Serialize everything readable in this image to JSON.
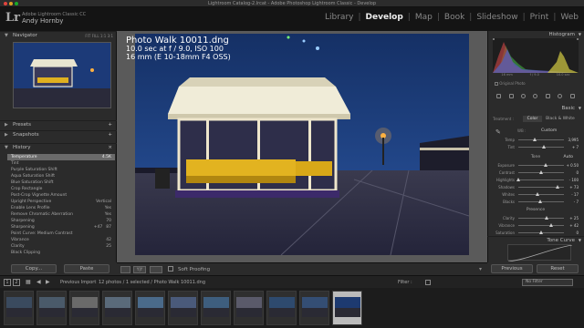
{
  "window": {
    "title": "Lightroom Catalog-2.lrcat - Adobe Photoshop Lightroom Classic - Develop"
  },
  "identity": {
    "logo": "Lr",
    "catalog_line": "Adobe Lightroom Classic CC",
    "user": "Andy Hornby"
  },
  "modules": [
    {
      "label": "Library",
      "active": false
    },
    {
      "label": "Develop",
      "active": true
    },
    {
      "label": "Map",
      "active": false
    },
    {
      "label": "Book",
      "active": false
    },
    {
      "label": "Slideshow",
      "active": false
    },
    {
      "label": "Print",
      "active": false
    },
    {
      "label": "Web",
      "active": false
    }
  ],
  "left_panel": {
    "navigator": {
      "label": "Navigator",
      "zoom": [
        "FIT",
        "FILL",
        "1:1",
        "3:1"
      ]
    },
    "presets": "Presets",
    "snapshots": "Snapshots",
    "history": {
      "label": "History",
      "items": [
        {
          "name": "Temperature",
          "a": "",
          "b": "4.5K",
          "sel": true
        },
        {
          "name": "Tint",
          "a": "",
          "b": "",
          "sel": false
        },
        {
          "name": "Purple Saturation Shift",
          "a": "",
          "b": "",
          "sel": false
        },
        {
          "name": "Aqua Saturation Shift",
          "a": "",
          "b": "",
          "sel": false
        },
        {
          "name": "Blue Saturation Shift",
          "a": "",
          "b": "",
          "sel": false
        },
        {
          "name": "Crop Rectangle",
          "a": "",
          "b": "",
          "sel": false
        },
        {
          "name": "Post-Crop Vignette Amount",
          "a": "",
          "b": "",
          "sel": false
        },
        {
          "name": "Upright Perspective",
          "a": "",
          "b": "Vertical",
          "sel": false
        },
        {
          "name": "Enable Lens Profile",
          "a": "",
          "b": "Yes",
          "sel": false
        },
        {
          "name": "Remove Chromatic Aberration",
          "a": "",
          "b": "Yes",
          "sel": false
        },
        {
          "name": "Sharpening",
          "a": "",
          "b": "70",
          "sel": false
        },
        {
          "name": "Sharpening",
          "a": "+47",
          "b": "87",
          "sel": false
        },
        {
          "name": "Point Curve: Medium Contrast",
          "a": "",
          "b": "",
          "sel": false
        },
        {
          "name": "Vibrance",
          "a": "",
          "b": "42",
          "sel": false
        },
        {
          "name": "Clarity",
          "a": "",
          "b": "25",
          "sel": false
        },
        {
          "name": "Black Clipping",
          "a": "",
          "b": "",
          "sel": false
        }
      ]
    },
    "copy_btn": "Copy...",
    "paste_btn": "Paste"
  },
  "photo_info": {
    "filename": "Photo Walk 10011.dng",
    "exposure": "10.0 sec at f / 9.0, ISO 100",
    "lens": "16 mm (E 10-18mm F4 OSS)"
  },
  "toolbar": {
    "soft_proofing": "Soft Proofing"
  },
  "right_panel": {
    "histogram_label": "Histogram",
    "histogram_info": [
      "16 mm",
      "f / 9.0",
      "10.0 sec"
    ],
    "original_photo": "Original Photo",
    "basic_label": "Basic",
    "treatment": {
      "label": "Treatment :",
      "color": "Color",
      "bw": "Black & White"
    },
    "wb": {
      "label": "WB :",
      "value": "Custom"
    },
    "sliders_wb": [
      {
        "label": "Temp",
        "value": "3,995",
        "pos": 0.35
      },
      {
        "label": "Tint",
        "value": "+ 7",
        "pos": 0.55
      }
    ],
    "tone": {
      "label": "Tone",
      "auto": "Auto"
    },
    "sliders_tone": [
      {
        "label": "Exposure",
        "value": "+ 0.50",
        "pos": 0.6
      },
      {
        "label": "Contrast",
        "value": "0",
        "pos": 0.5
      },
      {
        "label": "Highlights",
        "value": "- 100",
        "pos": 0.0
      },
      {
        "label": "Shadows",
        "value": "+ 73",
        "pos": 0.86
      },
      {
        "label": "Whites",
        "value": "- 17",
        "pos": 0.42
      },
      {
        "label": "Blacks",
        "value": "- 7",
        "pos": 0.47
      }
    ],
    "presence": "Presence",
    "sliders_presence": [
      {
        "label": "Clarity",
        "value": "+ 25",
        "pos": 0.62
      },
      {
        "label": "Vibrance",
        "value": "+ 42",
        "pos": 0.71
      },
      {
        "label": "Saturation",
        "value": "0",
        "pos": 0.5
      }
    ],
    "tone_curve": "Tone Curve",
    "previous_btn": "Previous",
    "reset_btn": "Reset"
  },
  "filmstrip": {
    "source": "Previous Import",
    "count": "12 photos / 1 selected / Photo Walk 10011.dng",
    "filter_label": "Filter :",
    "filter_value": "No Filter",
    "pages": [
      "1",
      "2"
    ]
  },
  "colors": {
    "accent": "#e8e8e8",
    "sky": "#1b3668"
  }
}
